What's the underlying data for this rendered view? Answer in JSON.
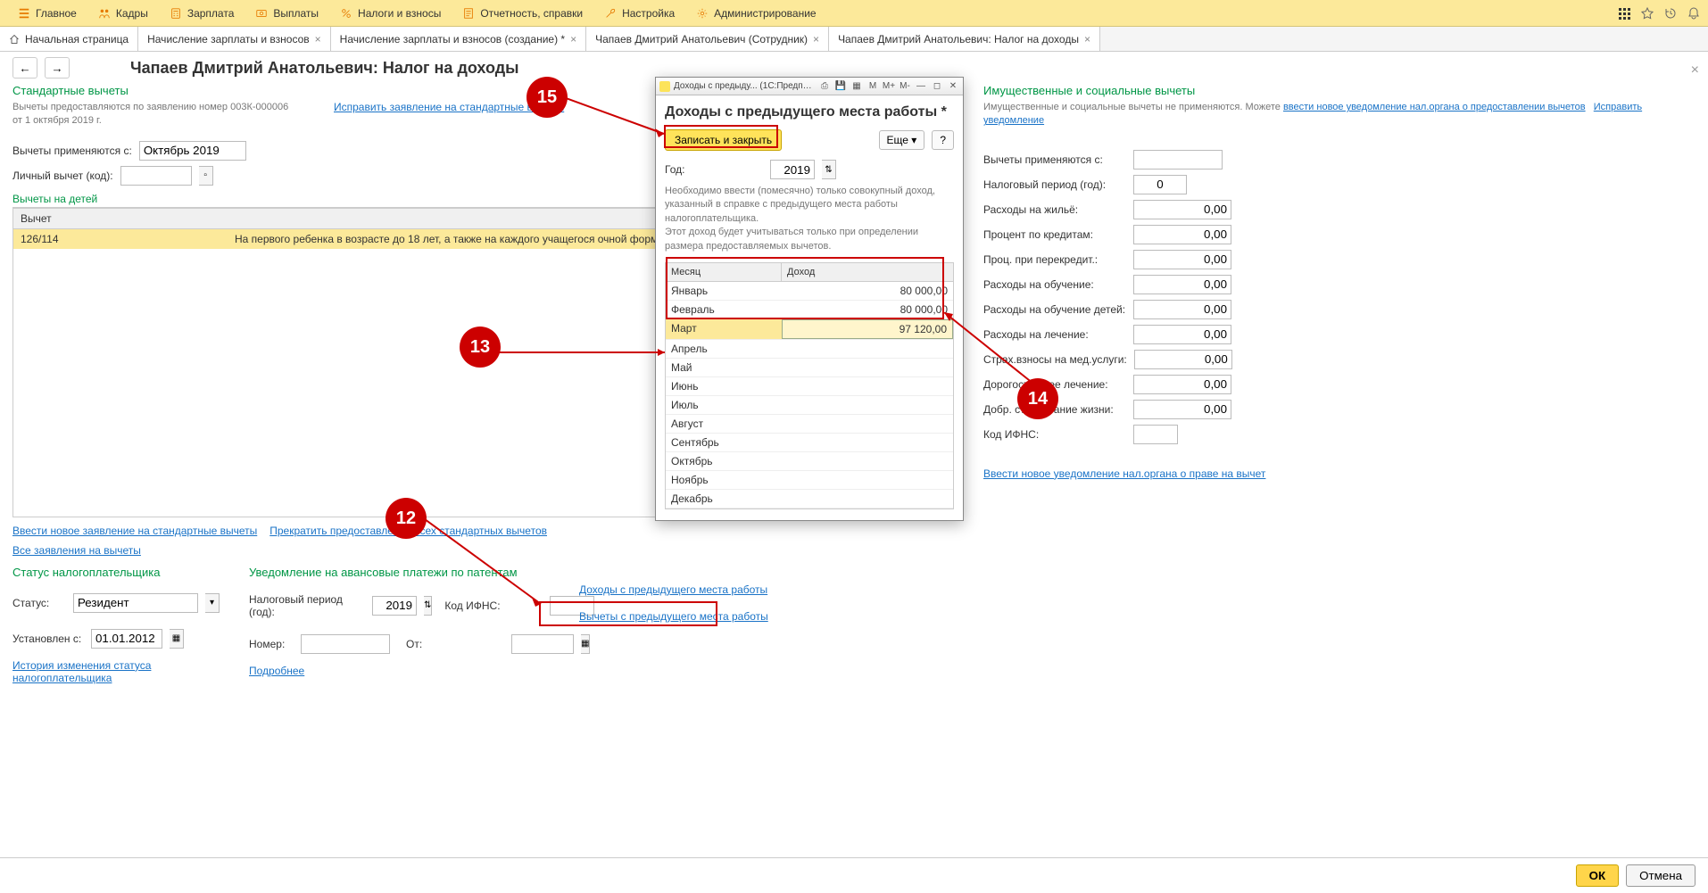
{
  "topbar": {
    "items": [
      {
        "label": "Главное"
      },
      {
        "label": "Кадры"
      },
      {
        "label": "Зарплата"
      },
      {
        "label": "Выплаты"
      },
      {
        "label": "Налоги и взносы"
      },
      {
        "label": "Отчетность, справки"
      },
      {
        "label": "Настройка"
      },
      {
        "label": "Администрирование"
      }
    ]
  },
  "tabs": [
    {
      "label": "Начальная страница",
      "home": true
    },
    {
      "label": "Начисление зарплаты и взносов",
      "closable": true
    },
    {
      "label": "Начисление зарплаты и взносов (создание) *",
      "closable": true
    },
    {
      "label": "Чапаев Дмитрий Анатольевич (Сотрудник)",
      "closable": true
    },
    {
      "label": "Чапаев Дмитрий Анатольевич: Налог на доходы",
      "closable": true,
      "active": true
    }
  ],
  "page": {
    "title": "Чапаев Дмитрий Анатольевич: Налог на доходы"
  },
  "standard": {
    "title": "Стандартные вычеты",
    "note": "Вычеты предоставляются по заявлению номер 003К-000006 от 1 октября 2019 г.",
    "fix_link": "Исправить заявление на стандартные вычеты",
    "apply_from_label": "Вычеты применяются с:",
    "apply_from": "Октябрь 2019",
    "personal_label": "Личный вычет (код):",
    "children_title": "Вычеты на детей",
    "table_head": "Вычет",
    "row_code": "126/114",
    "row_text": "На первого ребенка в возрасте до 18 лет, а также на каждого учащегося очной формы обучения,"
  },
  "links_block": {
    "new_std": "Ввести новое заявление на стандартные вычеты",
    "stop_std": "Прекратить предоставление всех стандартных вычетов",
    "all_apps": "Все заявления на вычеты"
  },
  "status": {
    "title": "Статус налогоплательщика",
    "status_label": "Статус:",
    "status_value": "Резидент",
    "set_from_label": "Установлен с:",
    "set_from": "01.01.2012",
    "history": "История изменения статуса налогоплательщика"
  },
  "patent": {
    "title": "Уведомление на авансовые платежи по патентам",
    "tax_year_label": "Налоговый период (год):",
    "tax_year": "2019",
    "ifns_label": "Код ИФНС:",
    "number_label": "Номер:",
    "from_label": "От:",
    "more": "Подробнее"
  },
  "prev_income_links": {
    "income": "Доходы с предыдущего места работы",
    "deductions": "Вычеты с предыдущего места работы"
  },
  "right": {
    "title": "Имущественные и социальные вычеты",
    "note1": "Имущественные и социальные вычеты не применяются. Можете",
    "note2": "ввести новое уведомление нал.органа о предоставлении вычетов",
    "fix_link": "Исправить уведомление",
    "apply_from_label": "Вычеты применяются с:",
    "tax_year_label": "Налоговый период (год):",
    "tax_year": "0",
    "rows": [
      {
        "label": "Расходы на жильё:",
        "val": "0,00"
      },
      {
        "label": "Процент по кредитам:",
        "val": "0,00"
      },
      {
        "label": "Проц. при перекредит.:",
        "val": "0,00"
      },
      {
        "label": "Расходы на обучение:",
        "val": "0,00"
      },
      {
        "label": "Расходы на обучение детей:",
        "val": "0,00"
      },
      {
        "label": "Расходы на лечение:",
        "val": "0,00"
      },
      {
        "label": "Страх.взносы на мед.услуги:",
        "val": "0,00"
      },
      {
        "label": "Дорогостоящее лечение:",
        "val": "0,00"
      },
      {
        "label": "Добр. страхование жизни:",
        "val": "0,00"
      }
    ],
    "ifns_label": "Код ИФНС:",
    "new_notice": "Ввести новое уведомление нал.органа о праве на вычет"
  },
  "modal": {
    "titlebar": "Доходы с предыду...  (1С:Предприятие)",
    "heading": "Доходы с предыдущего места работы *",
    "save_close": "Записать и закрыть",
    "more": "Еще",
    "help": "?",
    "year_label": "Год:",
    "year": "2019",
    "note": "Необходимо ввести (помесячно) только совокупный доход, указанный в справке с предыдущего места работы налогоплательщика.\nЭтот доход будет учитываться только при определении размера предоставляемых вычетов.",
    "head_month": "Месяц",
    "head_income": "Доход",
    "rows": [
      {
        "m": "Январь",
        "v": "80 000,00"
      },
      {
        "m": "Февраль",
        "v": "80 000,00"
      },
      {
        "m": "Март",
        "v": "97 120,00",
        "sel": true
      },
      {
        "m": "Апрель",
        "v": ""
      },
      {
        "m": "Май",
        "v": ""
      },
      {
        "m": "Июнь",
        "v": ""
      },
      {
        "m": "Июль",
        "v": ""
      },
      {
        "m": "Август",
        "v": ""
      },
      {
        "m": "Сентябрь",
        "v": ""
      },
      {
        "m": "Октябрь",
        "v": ""
      },
      {
        "m": "Ноябрь",
        "v": ""
      },
      {
        "m": "Декабрь",
        "v": ""
      }
    ]
  },
  "footer": {
    "ok": "ОК",
    "cancel": "Отмена"
  },
  "callouts": {
    "c12": "12",
    "c13": "13",
    "c14": "14",
    "c15": "15"
  }
}
